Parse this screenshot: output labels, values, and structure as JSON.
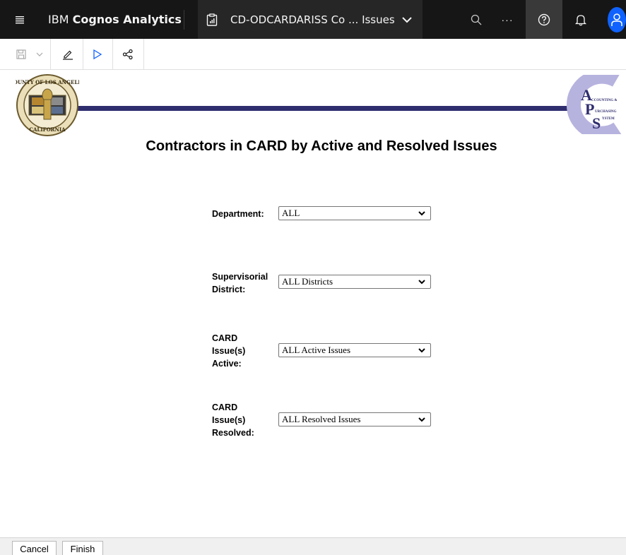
{
  "app": {
    "brand_prefix": "IBM ",
    "brand_name": "Cognos Analytics",
    "report_title": "CD-ODCARDARISS Co ... Issues"
  },
  "icons": {
    "menu": "hamburger-menu-icon",
    "report": "report-clipboard-icon",
    "chevron": "chevron-down-icon",
    "search": "search-icon",
    "more": "overflow-menu-icon",
    "help": "help-icon",
    "notifications": "notification-bell-icon",
    "user": "user-avatar-icon",
    "save": "save-icon",
    "edit": "edit-pencil-icon",
    "run": "run-play-icon",
    "share": "share-icon"
  },
  "topbar": {
    "more_label": "···"
  },
  "report": {
    "heading": "Contractors in CARD by Active and Resolved Issues",
    "seal_text_top": "COUNTY OF LOS ANGELES",
    "seal_text_bottom": "CALIFORNIA",
    "logo_lines": [
      "CCOUNTING &",
      "URCHASING",
      "YSTEM"
    ]
  },
  "prompts": [
    {
      "label_lines": [
        "Department:"
      ],
      "value": "ALL"
    },
    {
      "label_lines": [
        "Supervisorial",
        "District:"
      ],
      "value": "ALL Districts"
    },
    {
      "label_lines": [
        "CARD",
        "Issue(s)",
        "Active:"
      ],
      "value": "ALL Active Issues"
    },
    {
      "label_lines": [
        "CARD",
        "Issue(s)",
        "Resolved:"
      ],
      "value": "ALL Resolved Issues"
    }
  ],
  "footer": {
    "cancel_label": "Cancel",
    "finish_label": "Finish"
  },
  "colors": {
    "topbar_bg": "#161616",
    "accent_blue": "#0f62fe",
    "banner_navy": "#2f2d6e",
    "logo_lavender": "#b7b3df"
  }
}
